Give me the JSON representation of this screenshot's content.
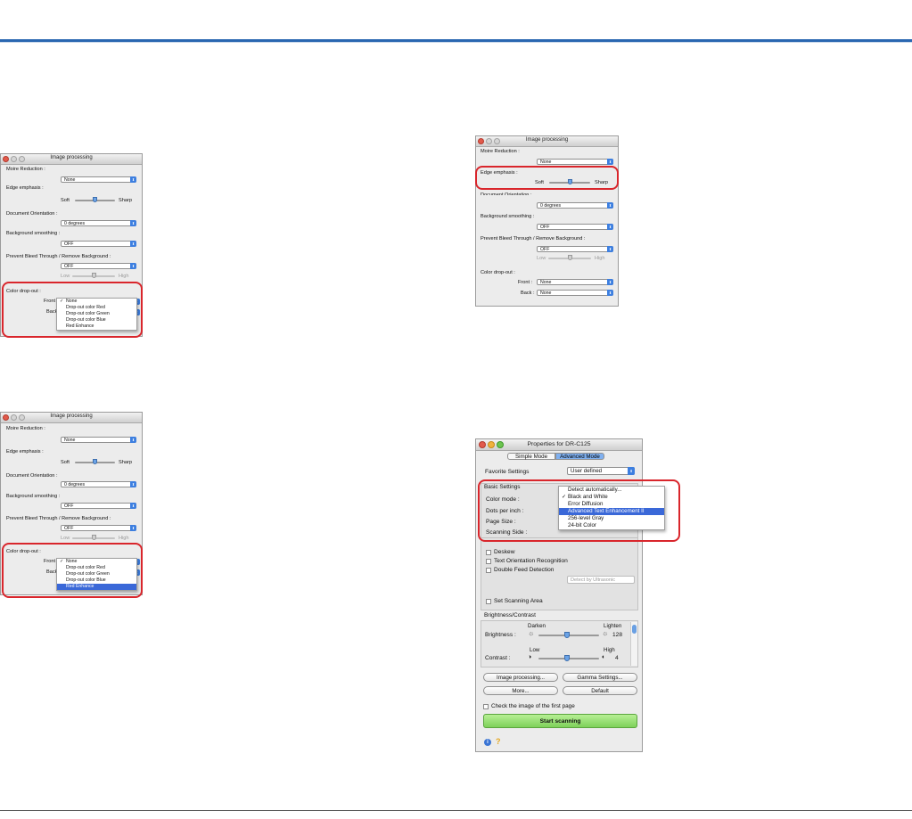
{
  "colors": {
    "accent": "#2a67b1",
    "highlight_red": "#d9262c",
    "menu_highlight": "#3a68d8",
    "start_green": "#7ed15a"
  },
  "image_processing": {
    "title": "Image processing",
    "moire_label": "Moire Reduction :",
    "moire_value": "None",
    "edge_label": "Edge emphasis :",
    "edge_soft": "Soft",
    "edge_sharp": "Sharp",
    "orientation_label": "Document Orientation :",
    "orientation_value": "0 degrees",
    "smoothing_label": "Background smoothing :",
    "smoothing_value": "OFF",
    "bleed_label": "Prevent Bleed Through / Remove Background :",
    "bleed_value": "OFF",
    "bleed_low": "Low",
    "bleed_high": "High",
    "dropout_label": "Color drop-out :",
    "front_label": "Front :",
    "back_label": "Back :",
    "front_value": "None",
    "back_value": "None",
    "dropout_options": [
      "None",
      "Drop-out color Red",
      "Drop-out color Green",
      "Drop-out color Blue",
      "Red Enhance"
    ],
    "check_mark": "✓",
    "front_trunc": "Front",
    "back_trunc": "Back"
  },
  "properties": {
    "title": "Properties for DR-C125",
    "tab_simple": "Simple Mode",
    "tab_advanced": "Advanced Mode",
    "favorite_label": "Favorite Settings",
    "favorite_value": "User defined",
    "basic_settings": "Basic Settings",
    "color_mode": "Color mode :",
    "dpi": "Dots per inch :",
    "page_size": "Page Size :",
    "scanning_side": "Scanning Side :",
    "color_options": [
      "Detect automatically...",
      "Black and White",
      "Error Diffusion",
      "Advanced Text Enhancement II",
      "256-level Gray",
      "24-bit Color"
    ],
    "deskew": "Deskew",
    "text_orientation": "Text Orientation Recognition",
    "double_feed": "Double Feed Detection",
    "detect_by": "Detect by Ultrasonic",
    "set_area": "Set Scanning Area",
    "brightness_contrast": "Brightness/Contrast",
    "darken": "Darken",
    "lighten": "Lighten",
    "brightness": "Brightness :",
    "brightness_value": "128",
    "low": "Low",
    "high": "High",
    "contrast": "Contrast :",
    "contrast_value": "4",
    "btn_image_processing": "Image processing...",
    "btn_gamma": "Gamma Settings...",
    "btn_more": "More...",
    "btn_default": "Default",
    "check_first_page": "Check the image of the first page",
    "start_scanning": "Start scanning",
    "info_icon": "i",
    "help_icon": "?"
  }
}
